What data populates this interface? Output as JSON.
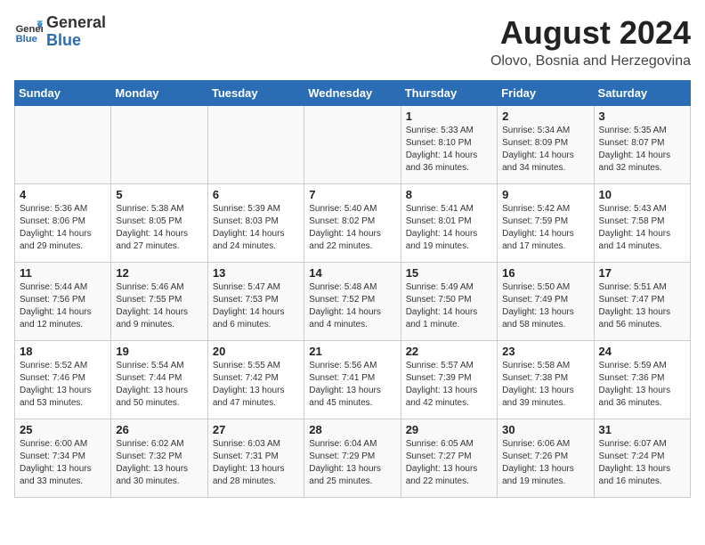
{
  "logo": {
    "general": "General",
    "blue": "Blue"
  },
  "title": "August 2024",
  "location": "Olovo, Bosnia and Herzegovina",
  "days_of_week": [
    "Sunday",
    "Monday",
    "Tuesday",
    "Wednesday",
    "Thursday",
    "Friday",
    "Saturday"
  ],
  "weeks": [
    [
      {
        "day": "",
        "content": ""
      },
      {
        "day": "",
        "content": ""
      },
      {
        "day": "",
        "content": ""
      },
      {
        "day": "",
        "content": ""
      },
      {
        "day": "1",
        "content": "Sunrise: 5:33 AM\nSunset: 8:10 PM\nDaylight: 14 hours and 36 minutes."
      },
      {
        "day": "2",
        "content": "Sunrise: 5:34 AM\nSunset: 8:09 PM\nDaylight: 14 hours and 34 minutes."
      },
      {
        "day": "3",
        "content": "Sunrise: 5:35 AM\nSunset: 8:07 PM\nDaylight: 14 hours and 32 minutes."
      }
    ],
    [
      {
        "day": "4",
        "content": "Sunrise: 5:36 AM\nSunset: 8:06 PM\nDaylight: 14 hours and 29 minutes."
      },
      {
        "day": "5",
        "content": "Sunrise: 5:38 AM\nSunset: 8:05 PM\nDaylight: 14 hours and 27 minutes."
      },
      {
        "day": "6",
        "content": "Sunrise: 5:39 AM\nSunset: 8:03 PM\nDaylight: 14 hours and 24 minutes."
      },
      {
        "day": "7",
        "content": "Sunrise: 5:40 AM\nSunset: 8:02 PM\nDaylight: 14 hours and 22 minutes."
      },
      {
        "day": "8",
        "content": "Sunrise: 5:41 AM\nSunset: 8:01 PM\nDaylight: 14 hours and 19 minutes."
      },
      {
        "day": "9",
        "content": "Sunrise: 5:42 AM\nSunset: 7:59 PM\nDaylight: 14 hours and 17 minutes."
      },
      {
        "day": "10",
        "content": "Sunrise: 5:43 AM\nSunset: 7:58 PM\nDaylight: 14 hours and 14 minutes."
      }
    ],
    [
      {
        "day": "11",
        "content": "Sunrise: 5:44 AM\nSunset: 7:56 PM\nDaylight: 14 hours and 12 minutes."
      },
      {
        "day": "12",
        "content": "Sunrise: 5:46 AM\nSunset: 7:55 PM\nDaylight: 14 hours and 9 minutes."
      },
      {
        "day": "13",
        "content": "Sunrise: 5:47 AM\nSunset: 7:53 PM\nDaylight: 14 hours and 6 minutes."
      },
      {
        "day": "14",
        "content": "Sunrise: 5:48 AM\nSunset: 7:52 PM\nDaylight: 14 hours and 4 minutes."
      },
      {
        "day": "15",
        "content": "Sunrise: 5:49 AM\nSunset: 7:50 PM\nDaylight: 14 hours and 1 minute."
      },
      {
        "day": "16",
        "content": "Sunrise: 5:50 AM\nSunset: 7:49 PM\nDaylight: 13 hours and 58 minutes."
      },
      {
        "day": "17",
        "content": "Sunrise: 5:51 AM\nSunset: 7:47 PM\nDaylight: 13 hours and 56 minutes."
      }
    ],
    [
      {
        "day": "18",
        "content": "Sunrise: 5:52 AM\nSunset: 7:46 PM\nDaylight: 13 hours and 53 minutes."
      },
      {
        "day": "19",
        "content": "Sunrise: 5:54 AM\nSunset: 7:44 PM\nDaylight: 13 hours and 50 minutes."
      },
      {
        "day": "20",
        "content": "Sunrise: 5:55 AM\nSunset: 7:42 PM\nDaylight: 13 hours and 47 minutes."
      },
      {
        "day": "21",
        "content": "Sunrise: 5:56 AM\nSunset: 7:41 PM\nDaylight: 13 hours and 45 minutes."
      },
      {
        "day": "22",
        "content": "Sunrise: 5:57 AM\nSunset: 7:39 PM\nDaylight: 13 hours and 42 minutes."
      },
      {
        "day": "23",
        "content": "Sunrise: 5:58 AM\nSunset: 7:38 PM\nDaylight: 13 hours and 39 minutes."
      },
      {
        "day": "24",
        "content": "Sunrise: 5:59 AM\nSunset: 7:36 PM\nDaylight: 13 hours and 36 minutes."
      }
    ],
    [
      {
        "day": "25",
        "content": "Sunrise: 6:00 AM\nSunset: 7:34 PM\nDaylight: 13 hours and 33 minutes."
      },
      {
        "day": "26",
        "content": "Sunrise: 6:02 AM\nSunset: 7:32 PM\nDaylight: 13 hours and 30 minutes."
      },
      {
        "day": "27",
        "content": "Sunrise: 6:03 AM\nSunset: 7:31 PM\nDaylight: 13 hours and 28 minutes."
      },
      {
        "day": "28",
        "content": "Sunrise: 6:04 AM\nSunset: 7:29 PM\nDaylight: 13 hours and 25 minutes."
      },
      {
        "day": "29",
        "content": "Sunrise: 6:05 AM\nSunset: 7:27 PM\nDaylight: 13 hours and 22 minutes."
      },
      {
        "day": "30",
        "content": "Sunrise: 6:06 AM\nSunset: 7:26 PM\nDaylight: 13 hours and 19 minutes."
      },
      {
        "day": "31",
        "content": "Sunrise: 6:07 AM\nSunset: 7:24 PM\nDaylight: 13 hours and 16 minutes."
      }
    ]
  ]
}
